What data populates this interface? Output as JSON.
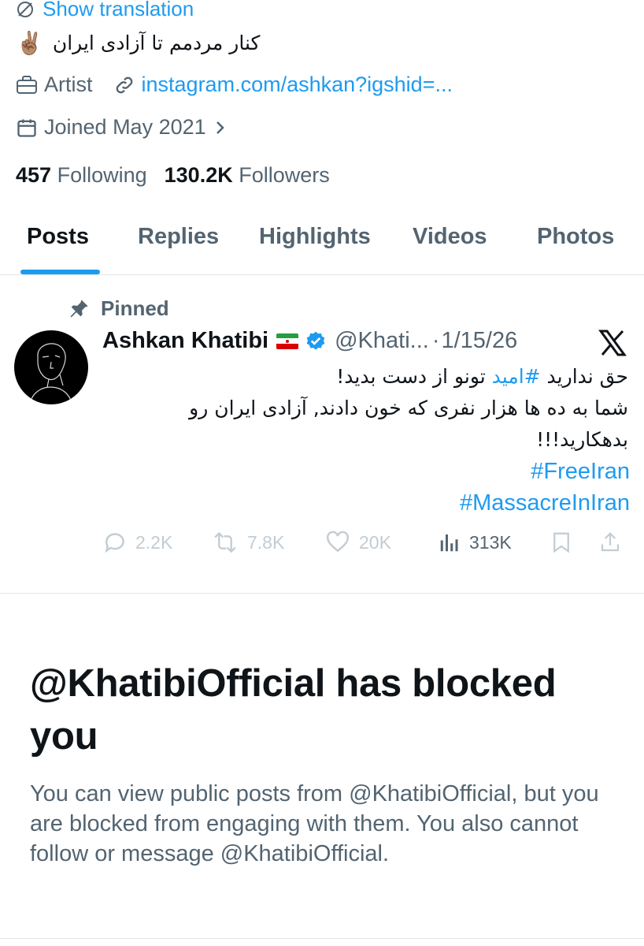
{
  "profile": {
    "show_translation": "Show translation",
    "bio_text": "کنار مردمم تا آزادی ایران",
    "bio_emoji": "✌🏽",
    "category": "Artist",
    "link": "instagram.com/ashkan?igshid=...",
    "joined": "Joined May 2021",
    "following_count": "457",
    "following_label": "Following",
    "followers_count": "130.2K",
    "followers_label": "Followers"
  },
  "tabs": [
    {
      "label": "Posts",
      "active": true
    },
    {
      "label": "Replies",
      "active": false
    },
    {
      "label": "Highlights",
      "active": false
    },
    {
      "label": "Videos",
      "active": false
    },
    {
      "label": "Photos",
      "active": false
    }
  ],
  "post": {
    "pinned_label": "Pinned",
    "author_name": "Ashkan Khatibi",
    "flag_emoji": "🇮🇷",
    "handle": "@Khati...",
    "separator": "·",
    "date": "1/15/26",
    "body": {
      "line1_pre": "حق ندارید ",
      "line1_hashtag": "#امید",
      "line1_post": " تونو از دست بدید!",
      "line2": "شما به ده ها هزار نفری که خون دادند, آزادی ایران رو",
      "line3": "بدهکارید!!!"
    },
    "hashtags": [
      "#FreeIran",
      "#MassacreInIran"
    ],
    "stats": {
      "replies": "2.2K",
      "reposts": "7.8K",
      "likes": "20K",
      "views": "313K"
    }
  },
  "blocked": {
    "title": "@KhatibiOfficial has blocked you",
    "description": "You can view public posts from @KhatibiOfficial, but you are blocked from engaging with them. You also cannot follow or message @KhatibiOfficial."
  },
  "colors": {
    "accent": "#1d9bf0",
    "text": "#0f1419",
    "secondary": "#536471",
    "muted": "#c2ccd3",
    "divider": "#e1e6ea"
  }
}
